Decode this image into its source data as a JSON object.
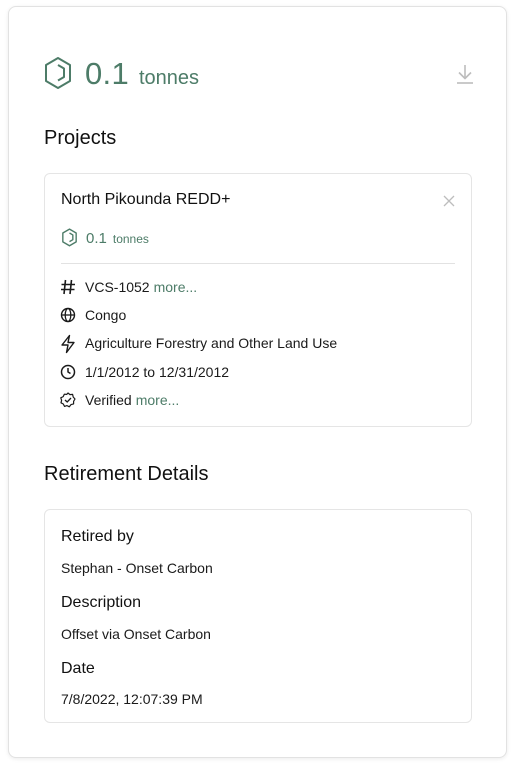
{
  "header": {
    "amount": "0.1",
    "unit": "tonnes",
    "amount_icon": "hexagon-cube-icon",
    "download_icon": "download-icon"
  },
  "colors": {
    "accent": "#4d7c68",
    "border": "#e5e5e5",
    "text": "#1a1a1a"
  },
  "projects": {
    "title": "Projects",
    "items": [
      {
        "name": "North Pikounda REDD+",
        "amount": "0.1",
        "unit": "tonnes",
        "details": {
          "id": "VCS-1052",
          "id_more": "more...",
          "country": "Congo",
          "category": "Agriculture Forestry and Other Land Use",
          "period": "1/1/2012 to 12/31/2012",
          "status": "Verified",
          "status_more": "more..."
        },
        "icons": {
          "id": "hash-icon",
          "country": "globe-icon",
          "category": "lightning-icon",
          "period": "clock-icon",
          "status": "verified-badge-icon",
          "close": "close-icon"
        }
      }
    ]
  },
  "retirement": {
    "title": "Retirement Details",
    "retired_by_label": "Retired by",
    "retired_by_value": "Stephan - Onset Carbon",
    "description_label": "Description",
    "description_value": "Offset via Onset Carbon",
    "date_label": "Date",
    "date_value": "7/8/2022, 12:07:39 PM"
  }
}
